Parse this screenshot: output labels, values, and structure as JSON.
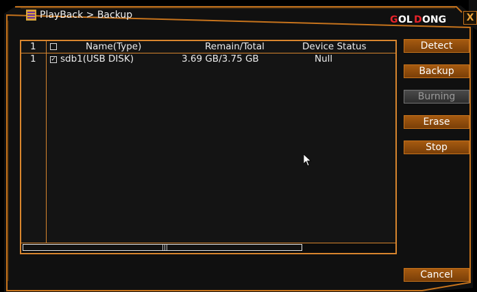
{
  "window": {
    "title": "PlayBack > Backup",
    "brand": "GOLDONG",
    "close_label": "X"
  },
  "table": {
    "headers": {
      "index": "1",
      "name": "Name(Type)",
      "remain_total": "Remain/Total",
      "status": "Device Status"
    },
    "rows": [
      {
        "index": "1",
        "name": "sdb1(USB DISK)",
        "remain_total": "3.69 GB/3.75 GB",
        "status": "Null",
        "checked": true
      }
    ]
  },
  "buttons": {
    "detect": "Detect",
    "backup": "Backup",
    "burning": "Burning",
    "erase": "Erase",
    "stop": "Stop",
    "cancel": "Cancel"
  },
  "colors": {
    "accent": "#d9862e",
    "brand_red": "#e8232a",
    "brand_white": "#ffffff",
    "button": "#8d4a0c"
  }
}
